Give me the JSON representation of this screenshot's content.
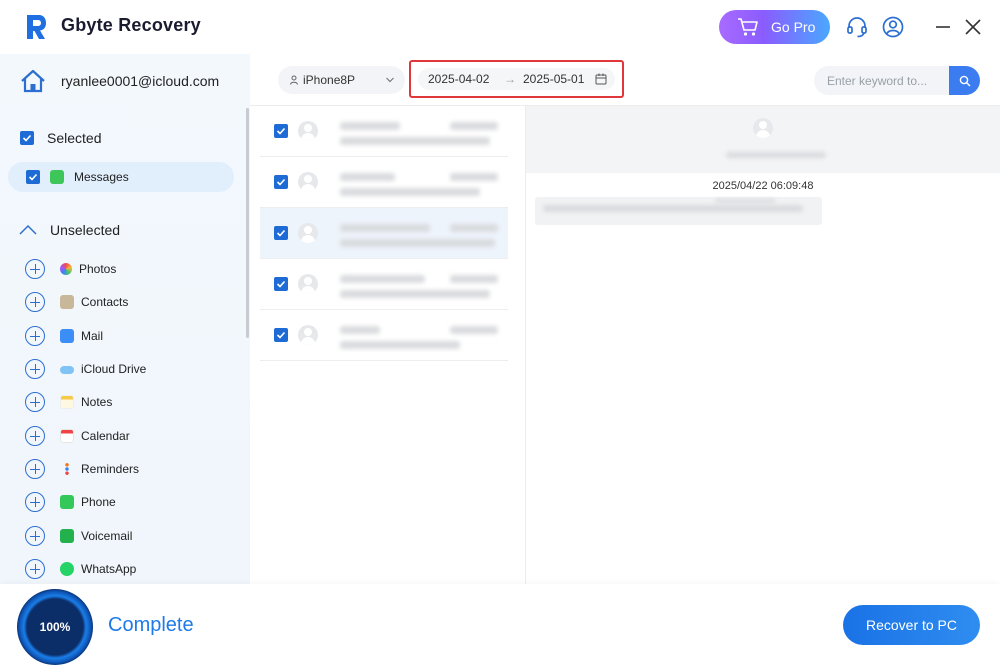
{
  "app": {
    "title": "Gbyte Recovery",
    "go_pro_label": "Go Pro"
  },
  "account": {
    "email": "ryanlee0001@icloud.com"
  },
  "sidebar": {
    "selected_label": "Selected",
    "selected_items": [
      {
        "label": "Messages",
        "icon": "messages-icon"
      }
    ],
    "unselected_label": "Unselected",
    "unselected_items": [
      {
        "label": "Photos",
        "icon": "photos-icon"
      },
      {
        "label": "Contacts",
        "icon": "contacts-icon"
      },
      {
        "label": "Mail",
        "icon": "mail-icon"
      },
      {
        "label": "iCloud Drive",
        "icon": "icloud-drive-icon"
      },
      {
        "label": "Notes",
        "icon": "notes-icon"
      },
      {
        "label": "Calendar",
        "icon": "calendar-icon"
      },
      {
        "label": "Reminders",
        "icon": "reminders-icon"
      },
      {
        "label": "Phone",
        "icon": "phone-icon"
      },
      {
        "label": "Voicemail",
        "icon": "voicemail-icon"
      },
      {
        "label": "WhatsApp",
        "icon": "whatsapp-icon"
      }
    ]
  },
  "toolbar": {
    "device": "iPhone8P",
    "date_from": "2025-04-02",
    "date_arrow": "→",
    "date_to": "2025-05-01",
    "search_placeholder": "Enter keyword to..."
  },
  "detail": {
    "timestamp": "2025/04/22 06:09:48"
  },
  "progress": {
    "percent_label": "100%",
    "percent": 100,
    "status": "Complete"
  },
  "actions": {
    "recover_label": "Recover to PC"
  },
  "colors": {
    "accent": "#1e6bd6",
    "highlight_border": "#e0373b",
    "complete_text": "#1e7ae8"
  }
}
